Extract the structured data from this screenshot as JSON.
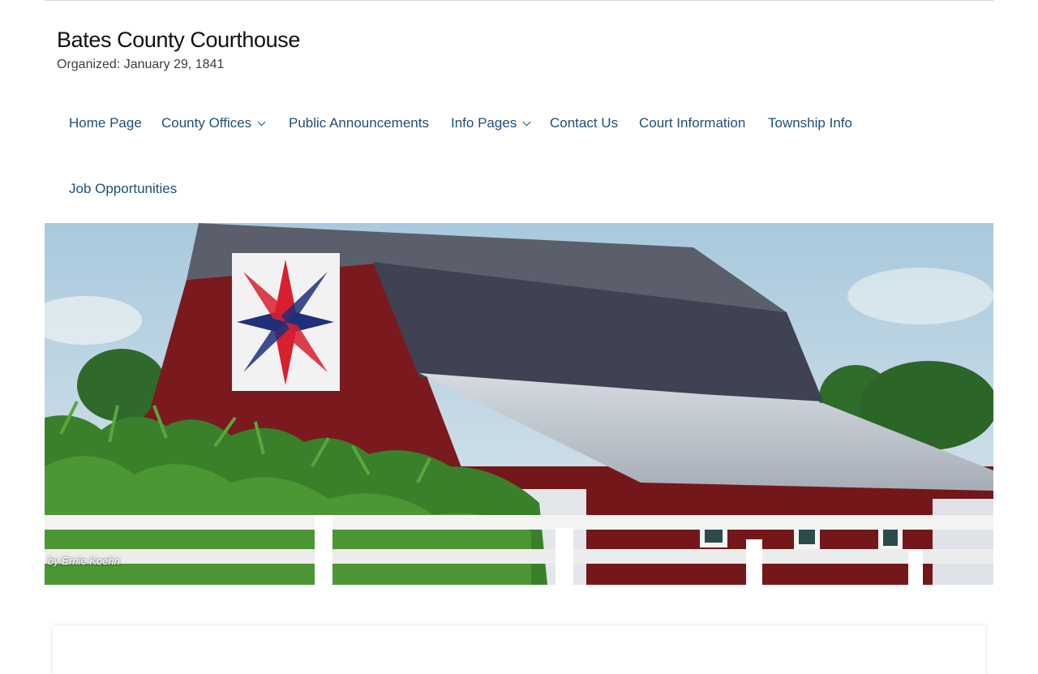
{
  "site": {
    "title": "Bates County Courthouse",
    "tagline": "Organized: January 29, 1841"
  },
  "nav": {
    "items": [
      {
        "label": "Home Page",
        "dropdown": false
      },
      {
        "label": "County Offices",
        "dropdown": true
      },
      {
        "label": "Public Announcements",
        "dropdown": false
      },
      {
        "label": "Info Pages",
        "dropdown": true
      },
      {
        "label": "Contact Us",
        "dropdown": false
      },
      {
        "label": "Court Information",
        "dropdown": false
      },
      {
        "label": "Township Info",
        "dropdown": false
      },
      {
        "label": "Job Opportunities",
        "dropdown": false
      }
    ]
  },
  "hero": {
    "caption": "by Ernie Koehn"
  },
  "colors": {
    "link": "#1d4f7a",
    "barn_red": "#7a1a1e",
    "roof": "#44485a"
  }
}
